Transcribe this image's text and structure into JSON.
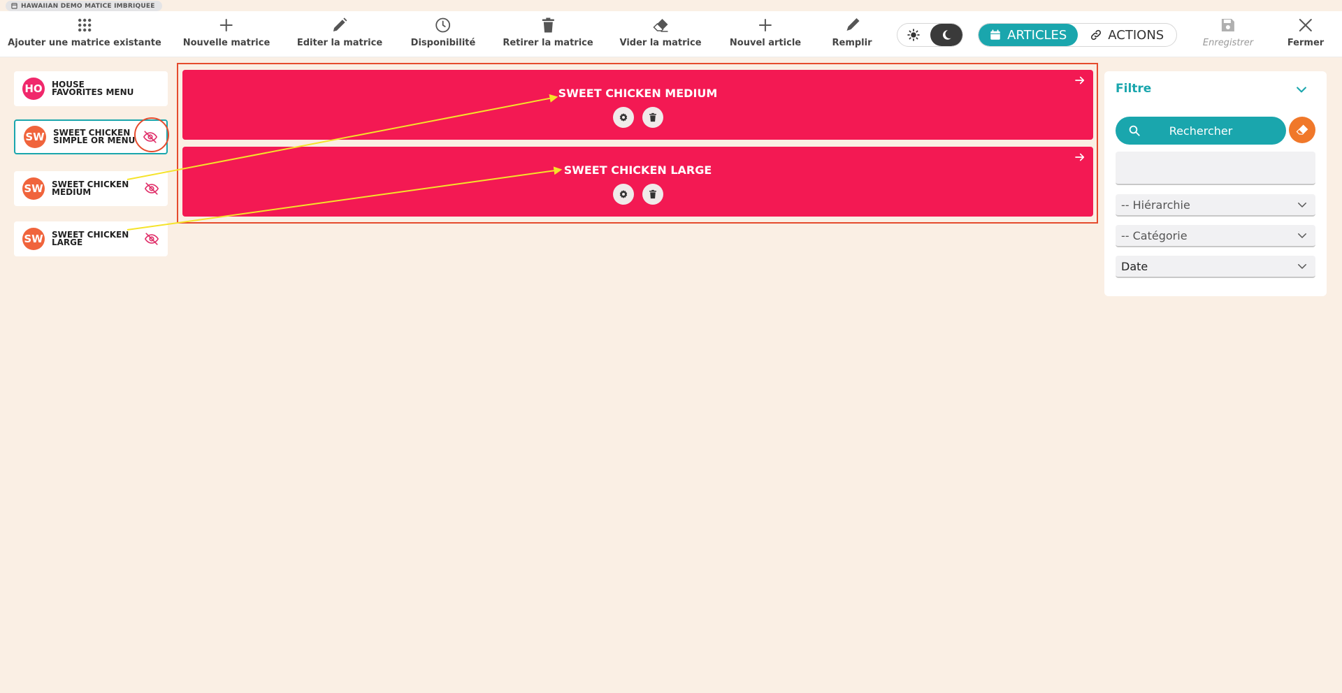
{
  "window": {
    "title": "HAWAIIAN DEMO MATICE IMBRIQUEE"
  },
  "toolbar": {
    "add_existing": "Ajouter une matrice existante",
    "new_matrix": "Nouvelle matrice",
    "edit_matrix": "Editer la matrice",
    "availability": "Disponibilité",
    "remove_matrix": "Retirer la matrice",
    "empty_matrix": "Vider la matrice",
    "new_article": "Nouvel article",
    "fill": "Remplir",
    "save": "Enregistrer",
    "close": "Fermer",
    "tab_articles": "ARTICLES",
    "tab_actions": "ACTIONS"
  },
  "sidebar": {
    "items": [
      {
        "initials": "HO",
        "label": "HOUSE FAVORITES MENU",
        "color": "#f0286b"
      },
      {
        "initials": "SW",
        "label": "SWEET CHICKEN SIMPLE OR MENU",
        "color": "#f0643c"
      },
      {
        "initials": "SW",
        "label": "SWEET CHICKEN MEDIUM",
        "color": "#f0643c"
      },
      {
        "initials": "SW",
        "label": "SWEET CHICKEN LARGE",
        "color": "#f0643c"
      }
    ]
  },
  "main": {
    "cards": [
      {
        "title": "SWEET CHICKEN MEDIUM"
      },
      {
        "title": "SWEET CHICKEN LARGE"
      }
    ]
  },
  "filter": {
    "title": "Filtre",
    "search_label": "Rechercher",
    "input_value": "",
    "hierarchy": "-- Hiérarchie",
    "category": "-- Catégorie",
    "date": "Date"
  },
  "colors": {
    "accent": "#1aa6ad",
    "card": "#f31953",
    "background": "#faefe4",
    "annotation_frame": "#e54b2d",
    "annotation_arrow": "#f5e32a",
    "eraser": "#f0782a"
  }
}
